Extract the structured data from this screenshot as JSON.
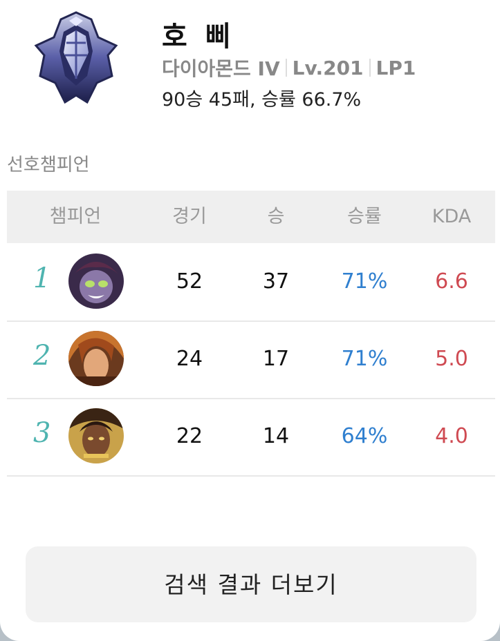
{
  "profile": {
    "name": "호 삐",
    "tier": "다이아몬드 IV",
    "level": "Lv.201",
    "lp": "LP1",
    "record": "90승 45패, 승률 66.7%",
    "emblem_icon": "diamond-rank-emblem"
  },
  "section_title": "선호챔피언",
  "table": {
    "headers": [
      "챔피언",
      "경기",
      "승",
      "승률",
      "KDA"
    ],
    "rows": [
      {
        "rank": "1",
        "games": "52",
        "wins": "37",
        "winrate": "71%",
        "kda": "6.6",
        "portrait_icon": "champion-portrait-1"
      },
      {
        "rank": "2",
        "games": "24",
        "wins": "17",
        "winrate": "71%",
        "kda": "5.0",
        "portrait_icon": "champion-portrait-2"
      },
      {
        "rank": "3",
        "games": "22",
        "wins": "14",
        "winrate": "64%",
        "kda": "4.0",
        "portrait_icon": "champion-portrait-3"
      }
    ]
  },
  "more_button": "검색 결과 더보기",
  "colors": {
    "rank_number": "#4fb4b0",
    "winrate": "#2f7fcf",
    "kda": "#cf4a52",
    "header_bg": "#efefef"
  }
}
